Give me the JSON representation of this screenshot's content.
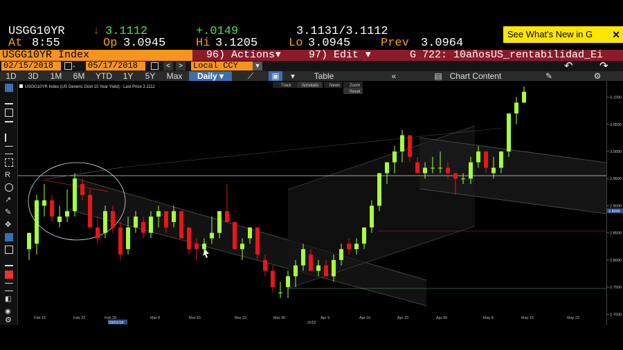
{
  "quote": {
    "ticker": "USGG10YR",
    "arrow": "↓",
    "last": "3.1112",
    "change": "+.0149",
    "bid_ask": "3.1131/3.1112",
    "at_label": "At",
    "time": "8:55",
    "open_label": "Op",
    "open": "3.0945",
    "hi_label": "Hi",
    "hi": "3.1205",
    "lo_label": "Lo",
    "lo": "3.0945",
    "prev_label": "Prev",
    "prev": "3.0964"
  },
  "promo": {
    "label": "See What's New in G",
    "close": "✕"
  },
  "function_bar": {
    "security": "USGG10YR Index",
    "actions": "96) Actions",
    "edit": "97) Edit",
    "chart_title": "G 722: 10añosUS_rentabilidad_Ei"
  },
  "date_bar": {
    "start": "02/15/2018",
    "end": "05/17/2018",
    "currency": "Local CCY",
    "prev_btn": "<",
    "next_btn": ">"
  },
  "period_bar": {
    "periods": [
      "1D",
      "3D",
      "1M",
      "6M",
      "YTD",
      "1Y",
      "5Y",
      "Max"
    ],
    "frequency": "Daily",
    "table": "Table",
    "collapse": "«",
    "chart_content": "Chart Content"
  },
  "chart_toolbar": {
    "track": "Track",
    "annotate": "Annotate",
    "news": "News",
    "zoom": "Zoom",
    "reset": "Reset"
  },
  "legend": "USGG10YR Index (US Generic Govt 10 Year Yield) - Last Price 3.1112",
  "last_price_tag": "2.8906",
  "colors": {
    "up": "#a8ff3e",
    "down": "#e8151b",
    "accent": "#f7941d",
    "bar": "#8b1a2b"
  },
  "chart_data": {
    "type": "candlestick",
    "ylim": [
      2.68,
      3.13
    ],
    "yticks": [
      "3.1000",
      "3.0500",
      "3.0000",
      "2.9500",
      "2.9000",
      "2.8500",
      "2.8000",
      "2.7500",
      "2.7000"
    ],
    "xticks": [
      "Feb 15",
      "Feb 22",
      "Feb 28",
      "Mar 8",
      "Mar 15",
      "Mar 23",
      "Mar 30",
      "Apr 9",
      "Apr 16",
      "Apr 23",
      "Apr 30",
      "May 8",
      "May 15",
      "May 23"
    ],
    "month_labels": [
      "03/01/18",
      "2018"
    ],
    "candles": [
      {
        "o": 2.82,
        "h": 2.85,
        "l": 2.8,
        "c": 2.85
      },
      {
        "o": 2.83,
        "h": 2.92,
        "l": 2.81,
        "c": 2.91
      },
      {
        "o": 2.9,
        "h": 2.94,
        "l": 2.88,
        "c": 2.91
      },
      {
        "o": 2.91,
        "h": 2.92,
        "l": 2.87,
        "c": 2.88
      },
      {
        "o": 2.87,
        "h": 2.9,
        "l": 2.86,
        "c": 2.88
      },
      {
        "o": 2.88,
        "h": 2.93,
        "l": 2.87,
        "c": 2.89
      },
      {
        "o": 2.89,
        "h": 2.96,
        "l": 2.88,
        "c": 2.95
      },
      {
        "o": 2.94,
        "h": 2.95,
        "l": 2.91,
        "c": 2.92
      },
      {
        "o": 2.92,
        "h": 2.93,
        "l": 2.86,
        "c": 2.86
      },
      {
        "o": 2.86,
        "h": 2.88,
        "l": 2.83,
        "c": 2.84
      },
      {
        "o": 2.85,
        "h": 2.9,
        "l": 2.84,
        "c": 2.89
      },
      {
        "o": 2.89,
        "h": 2.9,
        "l": 2.85,
        "c": 2.86
      },
      {
        "o": 2.86,
        "h": 2.87,
        "l": 2.8,
        "c": 2.81
      },
      {
        "o": 2.82,
        "h": 2.88,
        "l": 2.81,
        "c": 2.86
      },
      {
        "o": 2.86,
        "h": 2.89,
        "l": 2.85,
        "c": 2.88
      },
      {
        "o": 2.87,
        "h": 2.88,
        "l": 2.84,
        "c": 2.85
      },
      {
        "o": 2.85,
        "h": 2.89,
        "l": 2.84,
        "c": 2.88
      },
      {
        "o": 2.88,
        "h": 2.9,
        "l": 2.86,
        "c": 2.89
      },
      {
        "o": 2.89,
        "h": 2.89,
        "l": 2.85,
        "c": 2.86
      },
      {
        "o": 2.87,
        "h": 2.9,
        "l": 2.86,
        "c": 2.89
      },
      {
        "o": 2.89,
        "h": 2.89,
        "l": 2.84,
        "c": 2.84
      },
      {
        "o": 2.86,
        "h": 2.86,
        "l": 2.81,
        "c": 2.82
      },
      {
        "o": 2.83,
        "h": 2.84,
        "l": 2.8,
        "c": 2.82
      },
      {
        "o": 2.82,
        "h": 2.84,
        "l": 2.81,
        "c": 2.83
      },
      {
        "o": 2.84,
        "h": 2.88,
        "l": 2.83,
        "c": 2.85
      },
      {
        "o": 2.85,
        "h": 2.89,
        "l": 2.84,
        "c": 2.89
      },
      {
        "o": 2.89,
        "h": 2.94,
        "l": 2.87,
        "c": 2.87
      },
      {
        "o": 2.87,
        "h": 2.87,
        "l": 2.82,
        "c": 2.82
      },
      {
        "o": 2.82,
        "h": 2.84,
        "l": 2.8,
        "c": 2.83
      },
      {
        "o": 2.84,
        "h": 2.86,
        "l": 2.83,
        "c": 2.86
      },
      {
        "o": 2.86,
        "h": 2.86,
        "l": 2.8,
        "c": 2.81
      },
      {
        "o": 2.8,
        "h": 2.81,
        "l": 2.77,
        "c": 2.78
      },
      {
        "o": 2.78,
        "h": 2.79,
        "l": 2.74,
        "c": 2.75
      },
      {
        "o": 2.74,
        "h": 2.76,
        "l": 2.73,
        "c": 2.74
      },
      {
        "o": 2.75,
        "h": 2.78,
        "l": 2.73,
        "c": 2.77
      },
      {
        "o": 2.77,
        "h": 2.8,
        "l": 2.75,
        "c": 2.79
      },
      {
        "o": 2.79,
        "h": 2.83,
        "l": 2.78,
        "c": 2.82
      },
      {
        "o": 2.81,
        "h": 2.82,
        "l": 2.78,
        "c": 2.78
      },
      {
        "o": 2.78,
        "h": 2.8,
        "l": 2.77,
        "c": 2.79
      },
      {
        "o": 2.79,
        "h": 2.8,
        "l": 2.77,
        "c": 2.77
      },
      {
        "o": 2.77,
        "h": 2.81,
        "l": 2.76,
        "c": 2.8
      },
      {
        "o": 2.8,
        "h": 2.83,
        "l": 2.79,
        "c": 2.82
      },
      {
        "o": 2.83,
        "h": 2.84,
        "l": 2.81,
        "c": 2.82
      },
      {
        "o": 2.82,
        "h": 2.84,
        "l": 2.81,
        "c": 2.83
      },
      {
        "o": 2.83,
        "h": 2.86,
        "l": 2.82,
        "c": 2.86
      },
      {
        "o": 2.86,
        "h": 2.91,
        "l": 2.85,
        "c": 2.9
      },
      {
        "o": 2.9,
        "h": 2.96,
        "l": 2.89,
        "c": 2.96
      },
      {
        "o": 2.96,
        "h": 2.98,
        "l": 2.94,
        "c": 2.98
      },
      {
        "o": 2.98,
        "h": 3.01,
        "l": 2.96,
        "c": 3.0
      },
      {
        "o": 3.0,
        "h": 3.04,
        "l": 2.98,
        "c": 3.03
      },
      {
        "o": 3.03,
        "h": 3.03,
        "l": 2.98,
        "c": 2.99
      },
      {
        "o": 2.98,
        "h": 2.99,
        "l": 2.96,
        "c": 2.96
      },
      {
        "o": 2.96,
        "h": 2.98,
        "l": 2.95,
        "c": 2.97
      },
      {
        "o": 2.97,
        "h": 2.99,
        "l": 2.96,
        "c": 2.97
      },
      {
        "o": 2.97,
        "h": 3.0,
        "l": 2.96,
        "c": 2.97
      },
      {
        "o": 2.97,
        "h": 2.98,
        "l": 2.95,
        "c": 2.96
      },
      {
        "o": 2.96,
        "h": 2.96,
        "l": 2.92,
        "c": 2.95
      },
      {
        "o": 2.95,
        "h": 2.96,
        "l": 2.94,
        "c": 2.95
      },
      {
        "o": 2.95,
        "h": 2.99,
        "l": 2.94,
        "c": 2.98
      },
      {
        "o": 2.98,
        "h": 3.01,
        "l": 2.97,
        "c": 3.0
      },
      {
        "o": 3.0,
        "h": 3.0,
        "l": 2.96,
        "c": 2.97
      },
      {
        "o": 2.96,
        "h": 2.99,
        "l": 2.95,
        "c": 2.97
      },
      {
        "o": 2.97,
        "h": 3.0,
        "l": 2.96,
        "c": 3.0
      },
      {
        "o": 3.0,
        "h": 3.07,
        "l": 2.99,
        "c": 3.07
      },
      {
        "o": 3.07,
        "h": 3.1,
        "l": 3.05,
        "c": 3.09
      },
      {
        "o": 3.09,
        "h": 3.12,
        "l": 3.09,
        "c": 3.11
      }
    ]
  }
}
